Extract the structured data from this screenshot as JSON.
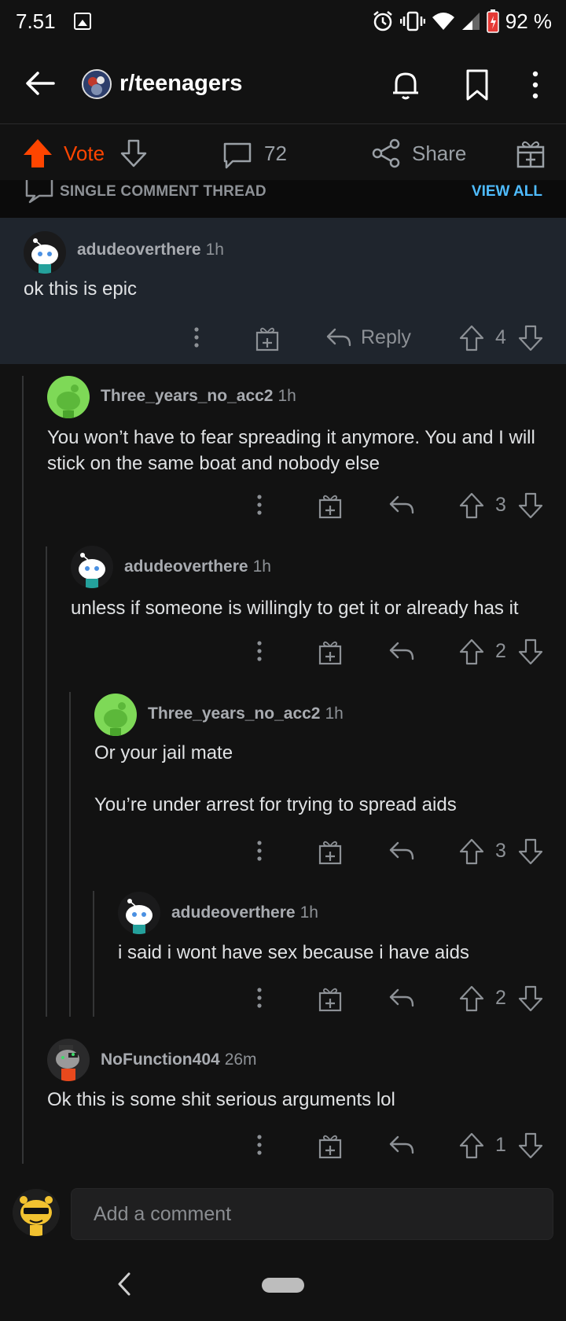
{
  "status_bar": {
    "time": "7.51",
    "battery_percent": "92 %",
    "icons": [
      "gallery-icon",
      "alarm-icon",
      "vibrate-icon",
      "wifi-icon",
      "signal-icon",
      "battery-icon"
    ]
  },
  "header": {
    "subreddit": "r/teenagers",
    "icons": [
      "back-arrow-icon",
      "subreddit-avatar",
      "bell-icon",
      "bookmark-icon",
      "more-vertical-icon"
    ]
  },
  "post_actions": {
    "vote_label": "Vote",
    "comment_count": "72",
    "share_label": "Share",
    "colors": {
      "upvote": "#ff4500"
    }
  },
  "thread_banner": {
    "label": "SINGLE COMMENT THREAD",
    "view_all": "VIEW ALL",
    "colors": {
      "link": "#4fbcff"
    }
  },
  "comments": [
    {
      "author": "adudeoverthere",
      "time": "1h",
      "body": "ok this is epic",
      "reply_label": "Reply",
      "score": "4",
      "avatar": "snoo-white-avatar"
    },
    {
      "author": "Three_years_no_acc2",
      "time": "1h",
      "body": "You won’t have to fear spreading it anymore. You and I will stick on the same boat and nobody else",
      "score": "3",
      "avatar": "snoo-green-avatar"
    },
    {
      "author": "adudeoverthere",
      "time": "1h",
      "body": "unless if someone is willingly to get it or already has it",
      "score": "2",
      "avatar": "snoo-white-avatar"
    },
    {
      "author": "Three_years_no_acc2",
      "time": "1h",
      "body": "Or your jail mate\n\nYou’re under arrest for trying to spread aids",
      "score": "3",
      "avatar": "snoo-green-avatar"
    },
    {
      "author": "adudeoverthere",
      "time": "1h",
      "body": "i said i wont have sex because i have aids",
      "score": "2",
      "avatar": "snoo-white-avatar"
    },
    {
      "author": "NoFunction404",
      "time": "26m",
      "body": "Ok this is some shit serious arguments lol",
      "score": "1",
      "avatar": "snoo-grey-avatar"
    }
  ],
  "composer": {
    "placeholder": "Add a comment"
  }
}
